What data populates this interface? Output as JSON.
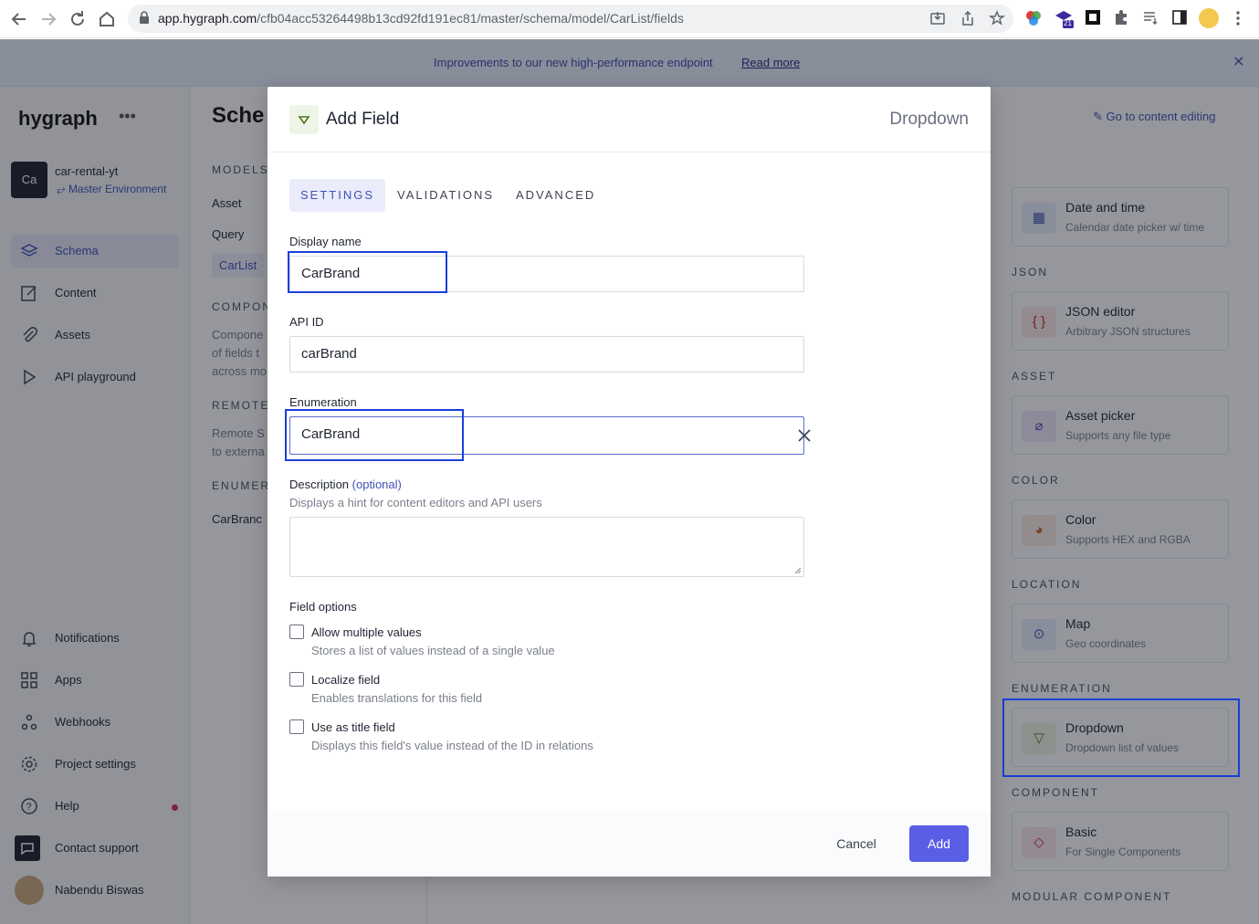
{
  "browser": {
    "url_host": "app.hygraph.com",
    "url_path": "/cfb04acc53264498b13cd92fd191ec81/master/schema/model/CarList/fields",
    "ext_badge": "21"
  },
  "banner": {
    "text": "Improvements to our new high-performance endpoint",
    "link": "Read more",
    "close": "×"
  },
  "sidebar": {
    "logo": "hygraph",
    "logo_more": "•••",
    "project_initials": "Ca",
    "project_name": "car-rental-yt",
    "environment": "Master Environment",
    "nav": [
      {
        "label": "Schema"
      },
      {
        "label": "Content"
      },
      {
        "label": "Assets"
      },
      {
        "label": "API playground"
      }
    ],
    "bottom": [
      {
        "label": "Notifications"
      },
      {
        "label": "Apps"
      },
      {
        "label": "Webhooks"
      },
      {
        "label": "Project settings"
      },
      {
        "label": "Help"
      },
      {
        "label": "Contact support"
      },
      {
        "label": "Nabendu Biswas"
      }
    ]
  },
  "models_panel": {
    "title": "Sche",
    "models_heading": "MODELS",
    "models": [
      "Asset",
      "Query",
      "CarList"
    ],
    "components_heading": "COMPON",
    "components_desc": [
      "Compone",
      "of fields t",
      "across mo"
    ],
    "remote_heading": "REMOTE",
    "remote_desc": [
      "Remote S",
      "to externa"
    ],
    "enum_heading": "ENUMERA",
    "enums": [
      "CarBranc"
    ]
  },
  "right_panel": {
    "goto": "Go to content editing",
    "sections": [
      {
        "heading": "JSON",
        "title": "JSON editor",
        "sub": "Arbitrary JSON structures"
      },
      {
        "heading": "ASSET",
        "title": "Asset picker",
        "sub": "Supports any file type"
      },
      {
        "heading": "COLOR",
        "title": "Color",
        "sub": "Supports HEX and RGBA"
      },
      {
        "heading": "LOCATION",
        "title": "Map",
        "sub": "Geo coordinates"
      },
      {
        "heading": "ENUMERATION",
        "title": "Dropdown",
        "sub": "Dropdown list of values"
      },
      {
        "heading": "COMPONENT",
        "title": "Basic",
        "sub": "For Single Components"
      }
    ],
    "date_card": {
      "title": "Date and time",
      "sub": "Calendar date picker w/ time"
    },
    "last_heading": "MODULAR COMPONENT"
  },
  "modal": {
    "title": "Add Field",
    "field_type": "Dropdown",
    "tabs": [
      "SETTINGS",
      "VALIDATIONS",
      "ADVANCED"
    ],
    "display_name_label": "Display name",
    "display_name_value": "CarBrand",
    "api_id_label": "API ID",
    "api_id_value": "carBrand",
    "enum_label": "Enumeration",
    "enum_value": "CarBrand",
    "description_label": "Description",
    "description_optional": "(optional)",
    "description_hint": "Displays a hint for content editors and API users",
    "field_options_label": "Field options",
    "options": [
      {
        "label": "Allow multiple values",
        "hint": "Stores a list of values instead of a single value"
      },
      {
        "label": "Localize field",
        "hint": "Enables translations for this field"
      },
      {
        "label": "Use as title field",
        "hint": "Displays this field's value instead of the ID in relations"
      }
    ],
    "cancel": "Cancel",
    "add": "Add"
  }
}
